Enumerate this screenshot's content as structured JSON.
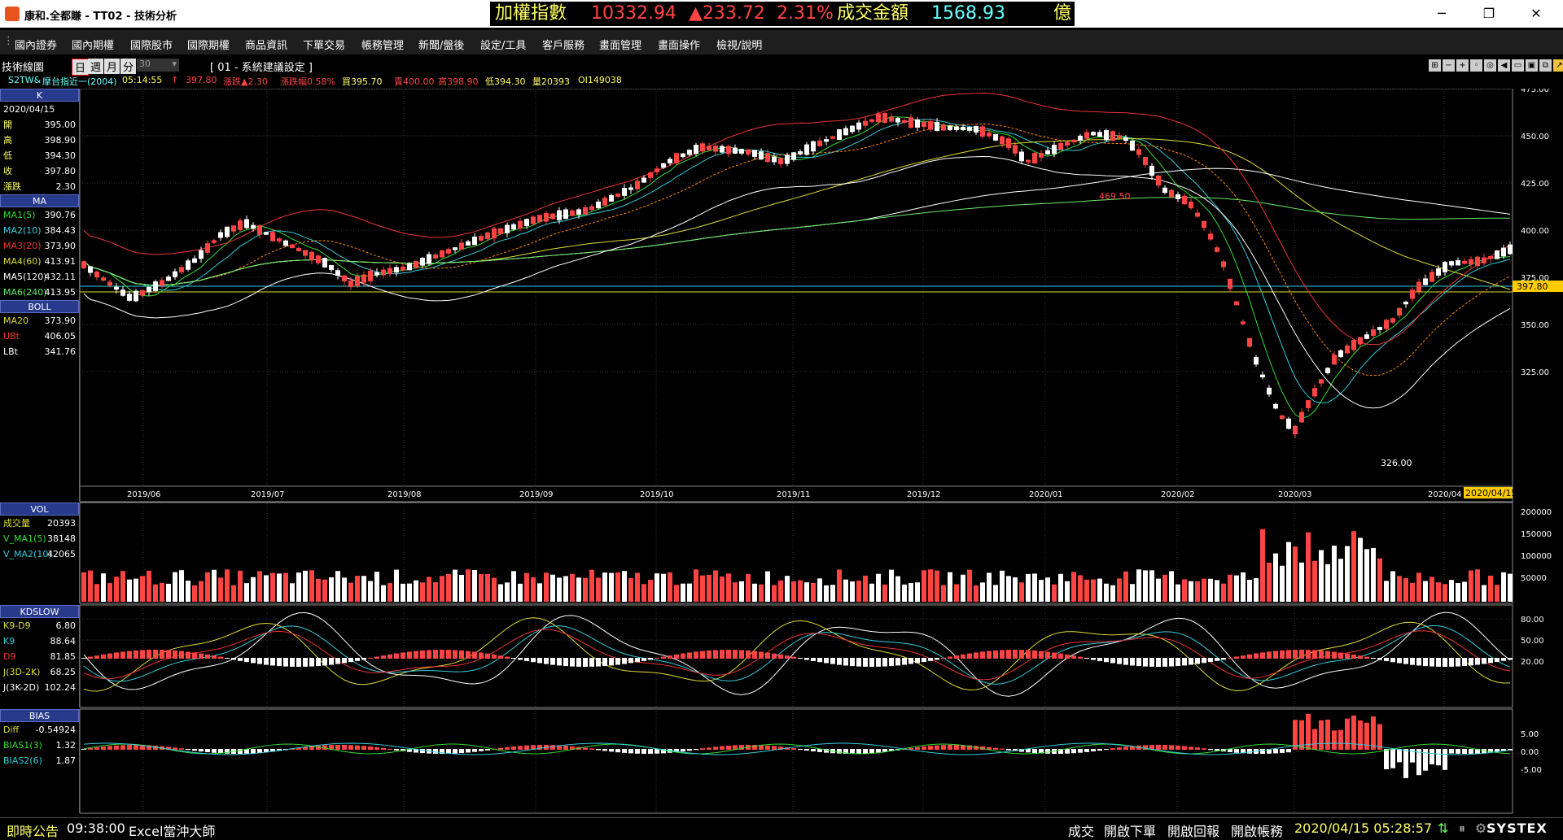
{
  "window": {
    "title": "康和.全都賺 - TT02 - 技術分析"
  },
  "ticker": {
    "index_label": "加權指數",
    "index_value": "10332.94",
    "change": "▲233.72",
    "pct": "2.31%",
    "turnover_label": "成交金額",
    "turnover_value": "1568.93",
    "unit": "億"
  },
  "menu": [
    "國內證券",
    "國內期權",
    "國際股市",
    "國際期權",
    "商品資訊",
    "下單交易",
    "帳務管理",
    "新聞/盤後",
    "設定/工具",
    "客戶服務",
    "畫面管理",
    "畫面操作",
    "檢視/說明"
  ],
  "toolbar": {
    "panel_title": "技術線圖",
    "periods": [
      "日",
      "週",
      "月",
      "分"
    ],
    "minute_value": "30",
    "scheme": "[ 01 - 系統建議設定 ]"
  },
  "quote_line": {
    "symbol": "S2TW&",
    "name": "摩台指近一(2004)",
    "time": "05:14:55",
    "arrow": "↑",
    "price": "397.80",
    "change": "漲跌▲2.30",
    "pct": "漲跌幅0.58%",
    "bid": "買395.70",
    "ask": "賣400.00",
    "high": "高398.90",
    "low": "低394.30",
    "volume": "量20393",
    "oi": "OI149038"
  },
  "sidebar": {
    "k_header": "K",
    "k_date": "2020/04/15",
    "k_rows": [
      {
        "label": "開",
        "value": "395.00"
      },
      {
        "label": "高",
        "value": "398.90"
      },
      {
        "label": "低",
        "value": "394.30"
      },
      {
        "label": "收",
        "value": "397.80"
      },
      {
        "label": "漲跌",
        "value": "2.30"
      }
    ],
    "ma_header": "MA",
    "ma_rows": [
      {
        "label": "MA1(5)",
        "value": "390.76",
        "color": "#33dd33"
      },
      {
        "label": "MA2(10)",
        "value": "384.43",
        "color": "#33ccdd"
      },
      {
        "label": "MA3(20)",
        "value": "373.90",
        "color": "#ee3333"
      },
      {
        "label": "MA4(60)",
        "value": "413.91",
        "color": "#dddd33"
      },
      {
        "label": "MA5(120)",
        "value": "432.11",
        "color": "#ffffff"
      },
      {
        "label": "MA6(240)",
        "value": "413.95",
        "color": "#66ee66"
      }
    ],
    "boll_header": "BOLL",
    "boll_rows": [
      {
        "label": "MA20",
        "value": "373.90",
        "color": "#dddd33"
      },
      {
        "label": "UBt",
        "value": "406.05",
        "color": "#ee3333"
      },
      {
        "label": "LBt",
        "value": "341.76",
        "color": "#ffffff"
      }
    ],
    "vol_header": "VOL",
    "vol_rows": [
      {
        "label": "成交量",
        "value": "20393",
        "color": "#dddd33"
      },
      {
        "label": "V_MA1(5)",
        "value": "38148",
        "color": "#33dd33"
      },
      {
        "label": "V_MA2(10)",
        "value": "42065",
        "color": "#33ccdd"
      }
    ],
    "kd_header": "KDSLOW",
    "kd_rows": [
      {
        "label": "K9-D9",
        "value": "6.80",
        "color": "#dddd33"
      },
      {
        "label": "K9",
        "value": "88.64",
        "color": "#33ccdd"
      },
      {
        "label": "D9",
        "value": "81.85",
        "color": "#ee3333"
      },
      {
        "label": "J(3D-2K)",
        "value": "68.25",
        "color": "#dddd33"
      },
      {
        "label": "J(3K-2D)",
        "value": "102.24",
        "color": "#ffffff"
      }
    ],
    "bias_header": "BIAS",
    "bias_rows": [
      {
        "label": "Diff",
        "value": "-0.54924",
        "color": "#dddd33"
      },
      {
        "label": "BIAS1(3)",
        "value": "1.32",
        "color": "#33dd33"
      },
      {
        "label": "BIAS2(6)",
        "value": "1.87",
        "color": "#33ccdd"
      }
    ]
  },
  "chart": {
    "price_ticks": [
      "475.00",
      "450.00",
      "425.00",
      "400.00",
      "375.00",
      "350.00",
      "325.00"
    ],
    "last_price": "397.80",
    "max_label": "469.50",
    "min_label": "326.00",
    "months": [
      "2019/06",
      "2019/07",
      "2019/08",
      "2019/09",
      "2019/10",
      "2019/11",
      "2019/12",
      "2020/01",
      "2020/02",
      "2020/03",
      "2020/04"
    ],
    "cursor_date": "2020/04/15",
    "vol_ticks": [
      "200000",
      "150000",
      "100000",
      "50000"
    ],
    "kd_ticks": [
      "80.00",
      "50.00",
      "20.00"
    ],
    "bias_ticks": [
      "5.00",
      "0.00",
      "-5.00"
    ]
  },
  "status": {
    "news_label": "即時公告",
    "news_time": "09:38:00",
    "news_text": "Excel當沖大師",
    "buttons": [
      "成交",
      "開啟下單",
      "開啟回報",
      "開啟帳務"
    ],
    "datetime": "2020/04/15 05:28:57",
    "brand": "SYSTEX"
  }
}
